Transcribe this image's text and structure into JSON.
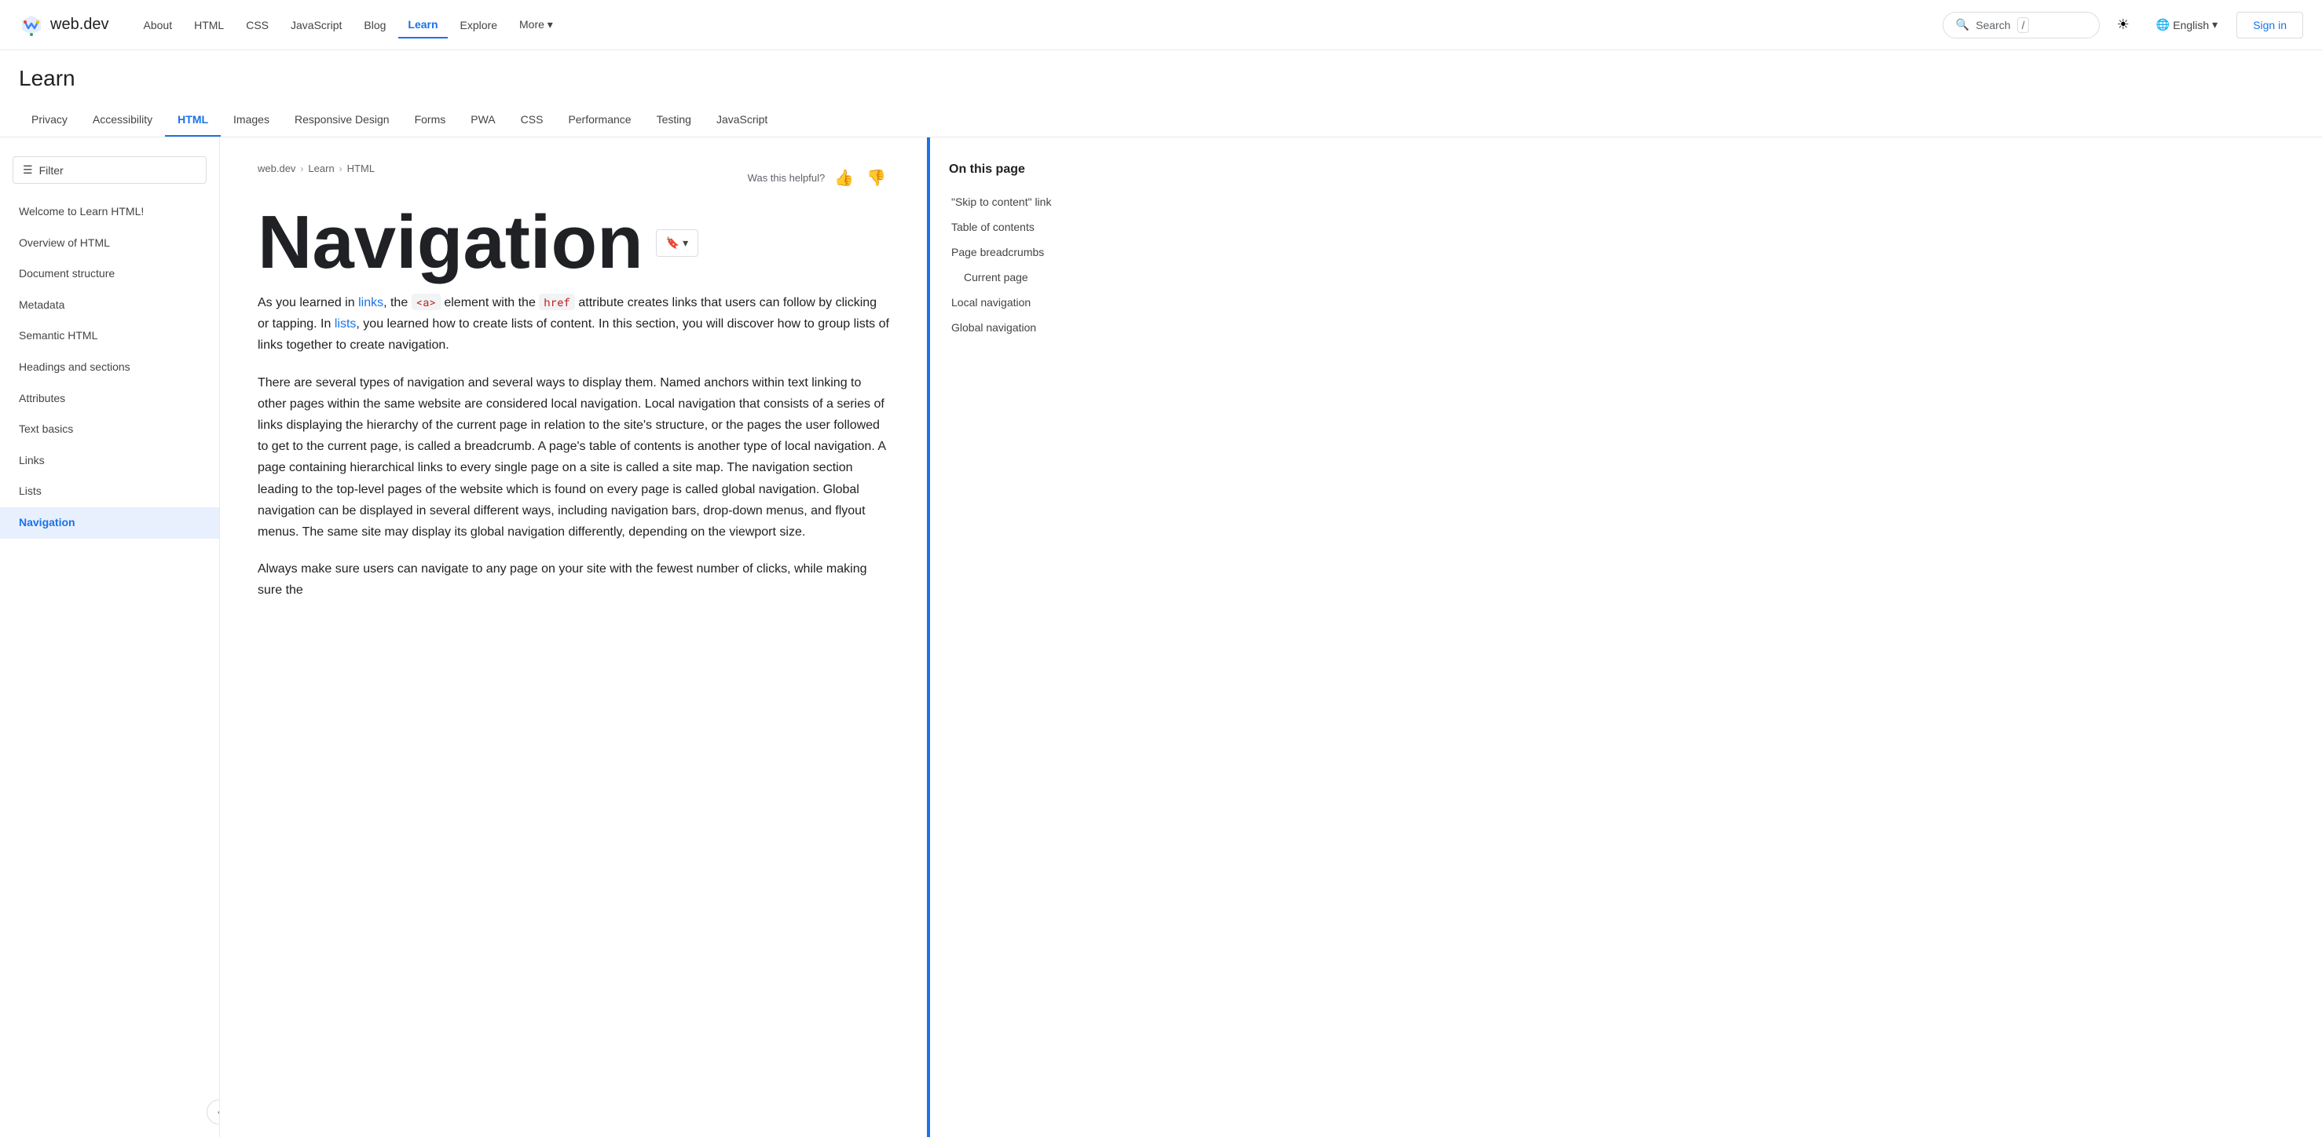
{
  "site": {
    "logo_text": "web.dev",
    "logo_icon_color1": "#4285f4",
    "logo_icon_color2": "#ea4335",
    "logo_icon_color3": "#fbbc04"
  },
  "top_nav": {
    "links": [
      {
        "label": "About",
        "active": false
      },
      {
        "label": "HTML",
        "active": false
      },
      {
        "label": "CSS",
        "active": false
      },
      {
        "label": "JavaScript",
        "active": false
      },
      {
        "label": "Blog",
        "active": false
      },
      {
        "label": "Learn",
        "active": true
      },
      {
        "label": "Explore",
        "active": false
      },
      {
        "label": "More",
        "active": false,
        "has_arrow": true
      }
    ],
    "search_placeholder": "Search",
    "search_shortcut": "/",
    "theme_icon": "☀",
    "language": "English",
    "sign_in": "Sign in"
  },
  "learn_header": {
    "title": "Learn"
  },
  "category_tabs": [
    {
      "label": "Privacy",
      "active": false
    },
    {
      "label": "Accessibility",
      "active": false
    },
    {
      "label": "HTML",
      "active": true
    },
    {
      "label": "Images",
      "active": false
    },
    {
      "label": "Responsive Design",
      "active": false
    },
    {
      "label": "Forms",
      "active": false
    },
    {
      "label": "PWA",
      "active": false
    },
    {
      "label": "CSS",
      "active": false
    },
    {
      "label": "Performance",
      "active": false
    },
    {
      "label": "Testing",
      "active": false
    },
    {
      "label": "JavaScript",
      "active": false
    }
  ],
  "sidebar": {
    "filter_label": "Filter",
    "items": [
      {
        "label": "Welcome to Learn HTML!",
        "active": false
      },
      {
        "label": "Overview of HTML",
        "active": false
      },
      {
        "label": "Document structure",
        "active": false
      },
      {
        "label": "Metadata",
        "active": false
      },
      {
        "label": "Semantic HTML",
        "active": false
      },
      {
        "label": "Headings and sections",
        "active": false
      },
      {
        "label": "Attributes",
        "active": false
      },
      {
        "label": "Text basics",
        "active": false
      },
      {
        "label": "Links",
        "active": false
      },
      {
        "label": "Lists",
        "active": false
      },
      {
        "label": "Navigation",
        "active": true
      }
    ]
  },
  "breadcrumb": {
    "items": [
      {
        "label": "web.dev"
      },
      {
        "label": "Learn"
      },
      {
        "label": "HTML"
      }
    ]
  },
  "content": {
    "helpful_label": "Was this helpful?",
    "title": "Navigation",
    "bookmark_label": "▼",
    "paragraphs": [
      "As you learned in {links}, the {a_tag} element with the {href_attr} attribute creates links that users can follow by clicking or tapping. In {lists}, you learned how to create lists of content. In this section, you will discover how to group lists of links together to create navigation.",
      "There are several types of navigation and several ways to display them. Named anchors within text linking to other pages within the same website are considered local navigation. Local navigation that consists of a series of links displaying the hierarchy of the current page in relation to the site's structure, or the pages the user followed to get to the current page, is called a breadcrumb. A page's table of contents is another type of local navigation. A page containing hierarchical links to every single page on a site is called a site map. The navigation section leading to the top-level pages of the website which is found on every page is called global navigation. Global navigation can be displayed in several different ways, including navigation bars, drop-down menus, and flyout menus. The same site may display its global navigation differently, depending on the viewport size.",
      "Always make sure users can navigate to any page on your site with the fewest number of clicks, while making sure the"
    ],
    "links_text": "links",
    "lists_text": "lists",
    "a_tag_text": "<a>",
    "href_text": "href"
  },
  "right_panel": {
    "title": "On this page",
    "toc_items": [
      {
        "label": "\"Skip to content\" link",
        "active": false,
        "sub": false
      },
      {
        "label": "Table of contents",
        "active": false,
        "sub": false
      },
      {
        "label": "Page breadcrumbs",
        "active": false,
        "sub": false
      },
      {
        "label": "Current page",
        "active": false,
        "sub": true
      },
      {
        "label": "Local navigation",
        "active": false,
        "sub": false
      },
      {
        "label": "Global navigation",
        "active": false,
        "sub": false
      }
    ]
  }
}
